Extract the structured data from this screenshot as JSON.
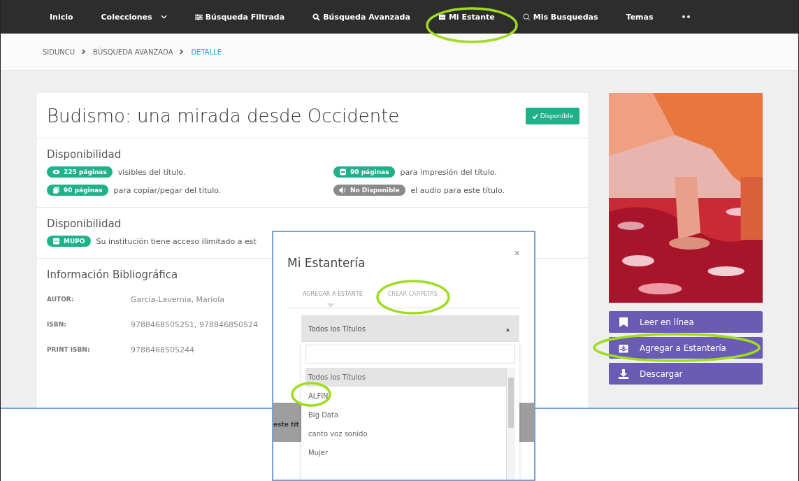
{
  "nav": {
    "items": [
      {
        "label": "Inicio",
        "kind": "plain"
      },
      {
        "label": "Colecciones",
        "kind": "menu"
      },
      {
        "label": "Búsqueda Filtrada",
        "kind": "filter"
      },
      {
        "label": "Búsqueda Avanzada",
        "kind": "search"
      },
      {
        "label": "Mi Estante",
        "kind": "shelf"
      },
      {
        "label": "Mis Busquedas",
        "kind": "saved"
      },
      {
        "label": "Temas",
        "kind": "plain"
      },
      {
        "label": "••",
        "kind": "plain"
      }
    ]
  },
  "breadcrumb": [
    {
      "label": "SIDUNCU",
      "current": false
    },
    {
      "label": "BÚSQUEDA AVANZADA",
      "current": false
    },
    {
      "label": "DETALLE",
      "current": true
    }
  ],
  "book": {
    "title": "Budismo: una mirada desde Occidente",
    "status": {
      "label": "Disponible",
      "available": true
    }
  },
  "availability": {
    "heading": "Disponibilidad",
    "items": [
      {
        "kind": "view",
        "badge": "225 páginas",
        "text": "visibles del título.",
        "available": true
      },
      {
        "kind": "print",
        "badge": "90 páginas",
        "text": "para impresión del título.",
        "available": true
      },
      {
        "kind": "copy",
        "badge": "90 páginas",
        "text": "para copiar/pegar del título.",
        "available": true
      },
      {
        "kind": "audio",
        "badge": "No Disponible",
        "text": "el audio para este título.",
        "available": false
      }
    ]
  },
  "access": {
    "heading": "Disponibilidad",
    "badge": "MUPO",
    "text": "Su institución tiene acceso ilimitado a est"
  },
  "bibliography": {
    "heading": "Información Bibliográfica",
    "rows": [
      {
        "label": "AUTOR:",
        "value": "García-Lavernia, Mariola"
      },
      {
        "label": "ISBN:",
        "value": "9788468505251, 978846850524"
      },
      {
        "label": "PRINT ISBN:",
        "value": "9788468505244"
      }
    ]
  },
  "actions": [
    {
      "label": "Leer en línea",
      "kind": "read"
    },
    {
      "label": "Agregar a Estantería",
      "kind": "shelf"
    },
    {
      "label": "Descargar",
      "kind": "download"
    }
  ],
  "behind_text": "este tít",
  "modal": {
    "title": "Mi Estantería",
    "close": "×",
    "tabs": [
      {
        "label": "AGREGAR A ESTANTE",
        "selected": true
      },
      {
        "label": "CREAR CARPETAS",
        "selected": false
      }
    ],
    "select": {
      "value": "Todos los Títulos",
      "caret": "▴",
      "options": [
        {
          "label": "Todos los Títulos",
          "selected": true
        },
        {
          "label": "ALFIN",
          "selected": false
        },
        {
          "label": "Big Data",
          "selected": false
        },
        {
          "label": "canto voz sonido",
          "selected": false
        },
        {
          "label": "Mujer",
          "selected": false
        }
      ]
    }
  }
}
